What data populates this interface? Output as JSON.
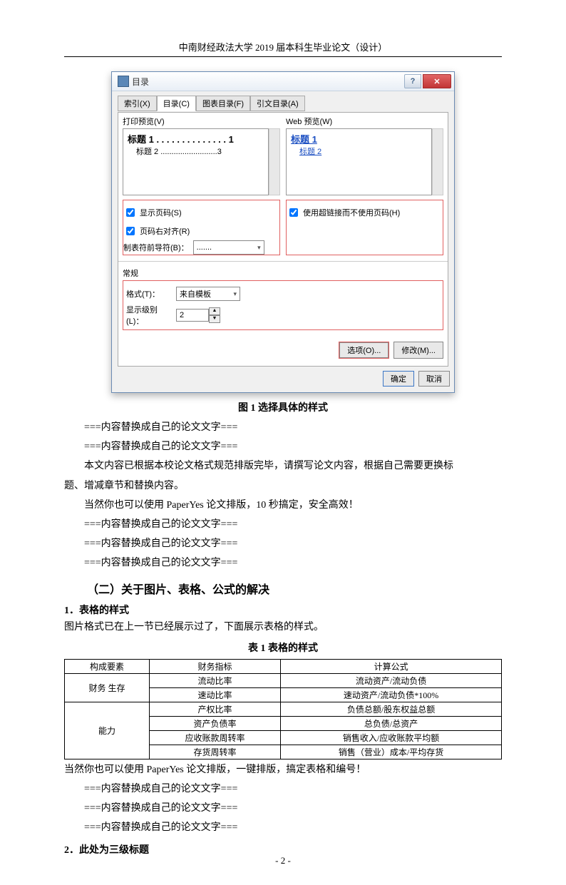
{
  "header": {
    "text": "中南财经政法大学 2019 届本科生毕业论文（设计）"
  },
  "dialog": {
    "title": "目录",
    "tabs": [
      "索引(X)",
      "目录(C)",
      "图表目录(F)",
      "引文目录(A)"
    ],
    "print_preview_label": "打印预览(V)",
    "web_preview_label": "Web 预览(W)",
    "preview": {
      "h1": "标题 1",
      "h1_page": "1",
      "h2": "标题 2",
      "h2_page": "3",
      "web_h1": "标题 1",
      "web_h2": "标题 2"
    },
    "chk_show_page": "显示页码(S)",
    "chk_right_align": "页码右对齐(R)",
    "leader_label": "制表符前导符(B)：",
    "leader_value": ".......",
    "chk_hyperlink": "使用超链接而不使用页码(H)",
    "general_label": "常规",
    "format_label": "格式(T)：",
    "format_value": "来自模板",
    "levels_label": "显示级别(L)：",
    "levels_value": "2",
    "btn_options": "选项(O)...",
    "btn_modify": "修改(M)...",
    "btn_ok": "确定",
    "btn_cancel": "取消"
  },
  "body": {
    "fig_caption": "图 1  选择具体的样式",
    "p1": "===内容替换成自己的论文文字===",
    "p2": "===内容替换成自己的论文文字===",
    "p3": "本文内容已根据本校论文格式规范排版完毕，请撰写论文内容，根据自己需要更换标",
    "p4": "题、增减章节和替换内容。",
    "p5": "当然你也可以使用 PaperYes 论文排版，10 秒搞定，安全高效！",
    "p6": "===内容替换成自己的论文文字===",
    "p7": "===内容替换成自己的论文文字===",
    "p8": "===内容替换成自己的论文文字===",
    "h2_1": "（二）关于图片、表格、公式的解决",
    "h3_1": "1．表格的样式",
    "p9": "图片格式已在上一节已经展示过了，下面展示表格的样式。",
    "table_caption": "表 1  表格的样式",
    "p10": "当然你也可以使用 PaperYes 论文排版，一键排版，搞定表格和编号！",
    "p11": "===内容替换成自己的论文文字===",
    "p12": "===内容替换成自己的论文文字===",
    "p13": "===内容替换成自己的论文文字===",
    "h3_2": "2．此处为三级标题"
  },
  "table": {
    "headers": [
      "构成要素",
      "财务指标",
      "计算公式"
    ],
    "rows": [
      [
        "财务\n生存",
        "流动比率",
        "流动资产/流动负债"
      ],
      [
        "",
        "速动比率",
        "速动资产/流动负债*100%"
      ],
      [
        "能力",
        "产权比率",
        "负债总额/股东权益总额"
      ],
      [
        "",
        "资产负债率",
        "总负债/总资产"
      ],
      [
        "",
        "应收账款周转率",
        "销售收入/应收账款平均额"
      ],
      [
        "",
        "存货周转率",
        "销售（营业）成本/平均存货"
      ]
    ]
  },
  "footer": {
    "page": "- 2 -"
  }
}
